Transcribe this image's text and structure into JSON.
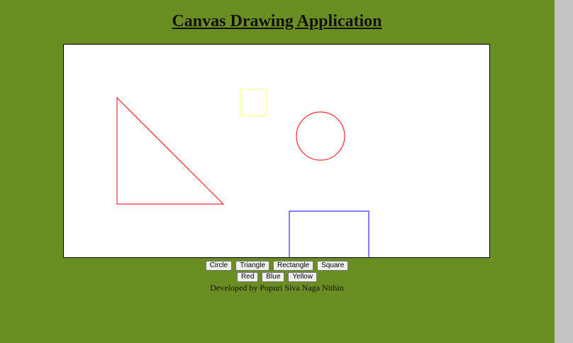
{
  "title": "Canvas Drawing Application",
  "canvas": {
    "shapes": [
      {
        "type": "triangle",
        "color": "#ff0000"
      },
      {
        "type": "square",
        "color": "#ffff66"
      },
      {
        "type": "circle",
        "color": "#ff0000"
      },
      {
        "type": "rectangle",
        "color": "#0000ff"
      }
    ]
  },
  "shape_buttons": [
    "Circle",
    "Triangle",
    "Rectangle",
    "Square"
  ],
  "color_buttons": [
    "Red",
    "Blue",
    "Yellow"
  ],
  "credit": "Developed by Popuri Siva Naga Nithin",
  "colors": {
    "background": "#6b8e23",
    "canvas": "#ffffff"
  }
}
